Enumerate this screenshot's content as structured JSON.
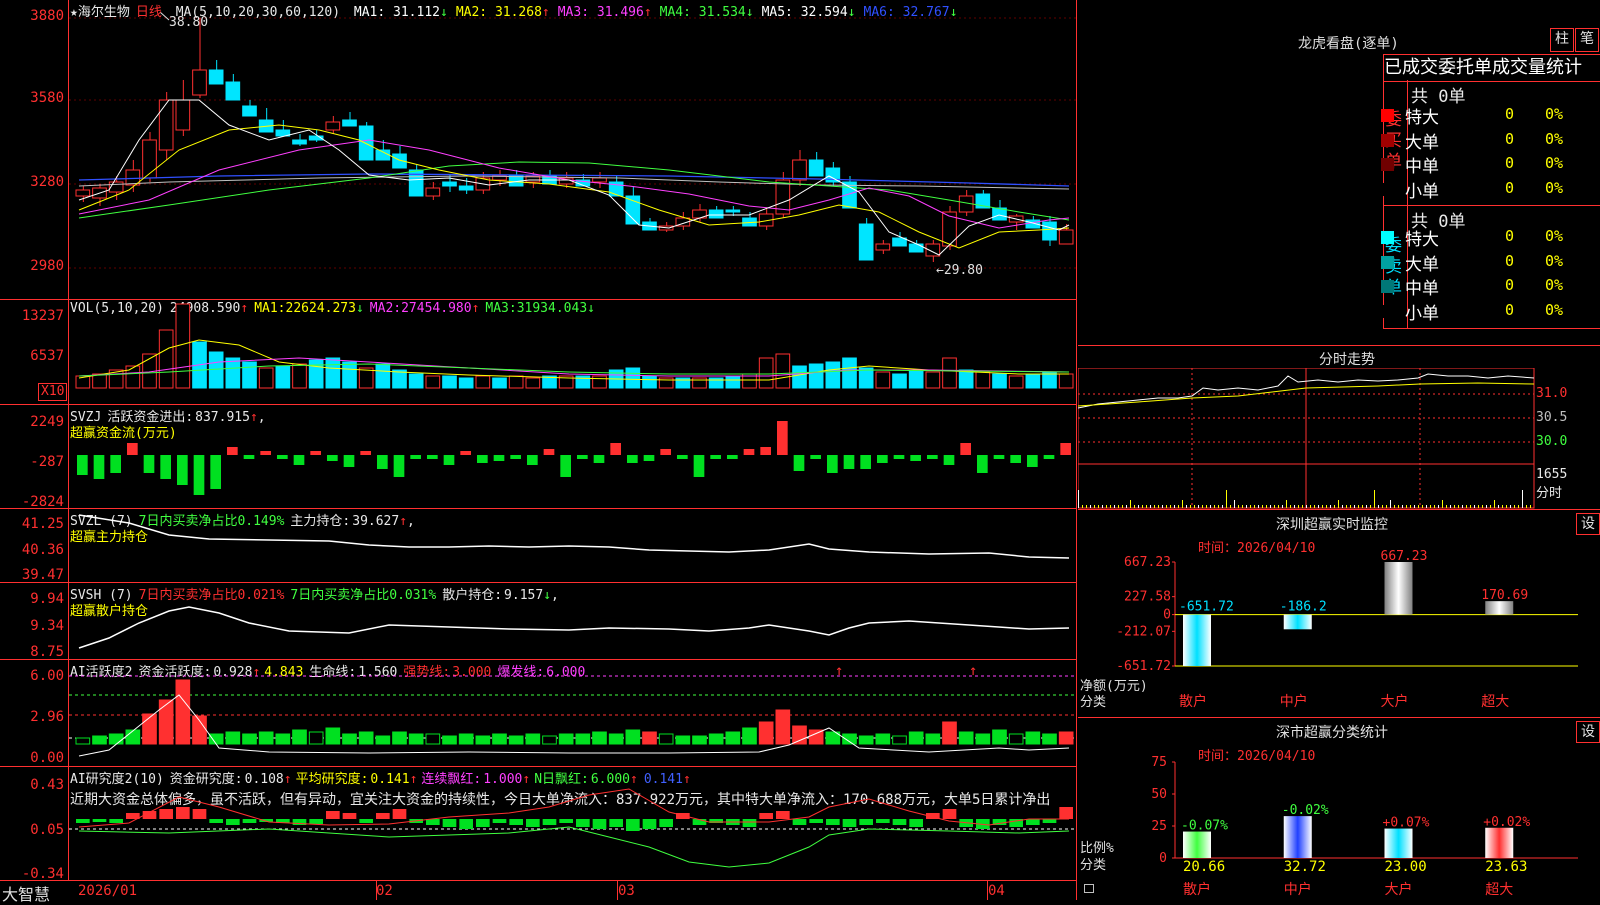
{
  "stock": {
    "name": "海尔生物",
    "period": "日线",
    "star": "★"
  },
  "colors": {
    "up": "#ff3030",
    "down": "#00e5ff",
    "bg": "#000000",
    "grid": "#a00000",
    "ma1": "#ffffff",
    "ma2": "#ffff00",
    "ma3": "#ff40ff",
    "ma4": "#40ff40",
    "ma5": "#c0c0c0",
    "ma6": "#3050ff"
  },
  "main_panel": {
    "ma_header": "MA(5,10,20,30,60,120)",
    "ma": [
      {
        "label": "MA1:",
        "value": "31.112",
        "arrow": "↓",
        "color": "#ffffff"
      },
      {
        "label": "MA2:",
        "value": "31.268",
        "arrow": "↑",
        "color": "#ffff00"
      },
      {
        "label": "MA3:",
        "value": "31.496",
        "arrow": "↑",
        "color": "#ff40ff"
      },
      {
        "label": "MA4:",
        "value": "31.534",
        "arrow": "↓",
        "color": "#40ff40"
      },
      {
        "label": "MA5:",
        "value": "32.594",
        "arrow": "↓",
        "color": "#ffffff"
      },
      {
        "label": "MA6:",
        "value": "32.767",
        "arrow": "↓",
        "color": "#3050ff"
      }
    ],
    "y_ticks": [
      "3880",
      "3580",
      "3280",
      "2980"
    ],
    "high_mark": "38.80",
    "low_mark": "←29.80"
  },
  "vol_panel": {
    "header": "VOL(5,10,20)",
    "value": "24908.590",
    "value_arrow": "↑",
    "ma": [
      {
        "label": "MA1:",
        "value": "22624.273",
        "arrow": "↓"
      },
      {
        "label": "MA2:",
        "value": "27454.980",
        "arrow": "↑"
      },
      {
        "label": "MA3:",
        "value": "31934.043",
        "arrow": "↓"
      }
    ],
    "y_ticks": [
      "13237",
      "6537"
    ],
    "unit": "X10"
  },
  "svzj_panel": {
    "header": "SVZJ",
    "label": "活跃资金进出:",
    "value": "837.915",
    "arrow": "↑",
    "tail": ",",
    "sub": "超赢资金流(万元)",
    "y_ticks": [
      "2249",
      "-287",
      "-2824"
    ]
  },
  "svzl_panel": {
    "header": "SVZL (7)",
    "ratio_label": "7日内买卖净占比",
    "ratio_value": "0.149%",
    "hold_label": "主力持仓:",
    "hold_value": "39.627",
    "arrow": "↑",
    "tail": ",",
    "sub": "超赢主力持仓",
    "y_ticks": [
      "41.25",
      "40.36",
      "39.47"
    ]
  },
  "svsh_panel": {
    "header": "SVSH (7)",
    "r1_label": "7日内买卖净占比",
    "r1_value": "0.021%",
    "r2_label": "7日内买卖净占比",
    "r2_value": "0.031%",
    "hold_label": "散户持仓:",
    "hold_value": "9.157",
    "arrow": "↓",
    "tail": ",",
    "sub": "超赢散户持仓",
    "y_ticks": [
      "9.94",
      "9.34",
      "8.75"
    ]
  },
  "ai_active_panel": {
    "header": "AI活跃度2",
    "l1": "资金活跃度:",
    "v1": "0.928",
    "a1": "↑",
    "v2": "4.843",
    "l3": "生命线:",
    "v3": "1.560",
    "l4": "强势线:",
    "v4": "3.000",
    "l5": "爆发线:",
    "v5": "6.000",
    "y_ticks": [
      "6.00",
      "2.96",
      "0.00"
    ]
  },
  "ai_research_panel": {
    "header": "AI研究度2(10)",
    "l1": "资金研究度:",
    "v1": "0.108",
    "a1": "↑",
    "l2": "平均研究度:",
    "v2": "0.141",
    "a2": "↑",
    "l3": "连续飘红:",
    "v3": "1.000",
    "a3": "↑",
    "l4": "N日飘红:",
    "v4": "6.000",
    "a4": "↑",
    "v5": "0.141",
    "a5": "↑",
    "comment": "近期大资金总体偏多，虽不活跃，但有异动，宜关注大资金的持续性，今日大单净流入：837.922万元，其中特大单净流入：170.688万元，大单5日累计净出",
    "y_ticks": [
      "0.43",
      "0.05",
      "-0.34"
    ]
  },
  "date_axis": {
    "labels": [
      "2026/01",
      "02",
      "03",
      "04"
    ]
  },
  "brand": "大智慧",
  "longhu": {
    "title": "龙虎看盘(逐单)",
    "btn_zhu": "柱",
    "btn_bi": "笔",
    "tabs": "已成交委托单成交量统计",
    "buy": {
      "side": "委买单",
      "count": "共 0单",
      "rows": [
        {
          "label": "特大",
          "value": "0",
          "pct": "0%",
          "color": "#ff0000"
        },
        {
          "label": "大单",
          "value": "0",
          "pct": "0%",
          "color": "#a00000"
        },
        {
          "label": "中单",
          "value": "0",
          "pct": "0%",
          "color": "#700000"
        },
        {
          "label": "小单",
          "value": "0",
          "pct": "0%",
          "color": "#000000"
        }
      ]
    },
    "sell": {
      "side": "委卖单",
      "count": "共 0单",
      "rows": [
        {
          "label": "特大",
          "value": "0",
          "pct": "0%",
          "color": "#00ffff"
        },
        {
          "label": "大单",
          "value": "0",
          "pct": "0%",
          "color": "#00a0a0"
        },
        {
          "label": "中单",
          "value": "0",
          "pct": "0%",
          "color": "#007878"
        },
        {
          "label": "小单",
          "value": "0",
          "pct": "0%",
          "color": "#000000"
        }
      ]
    }
  },
  "intraday": {
    "title": "分时走势",
    "price_ticks": [
      "31.0",
      "30.5",
      "30.0"
    ],
    "vol_tick": "1655",
    "vol_unit": "分时"
  },
  "sz_monitor": {
    "title": "深圳超赢实时监控",
    "btn": "设",
    "time": "时间：2026/04/10",
    "y_ticks": [
      "667.23",
      "227.58",
      "0",
      "-212.07",
      "-651.72"
    ],
    "bars": [
      {
        "cat": "散户",
        "value": -651.72,
        "label": "-651.72"
      },
      {
        "cat": "中户",
        "value": -186.2,
        "label": "-186.2"
      },
      {
        "cat": "大户",
        "value": 667.23,
        "label": "667.23"
      },
      {
        "cat": "超大",
        "value": 170.69,
        "label": "170.69"
      }
    ],
    "ylabel": "净额(万元)",
    "xlabel": "分类"
  },
  "sz_classify": {
    "title": "深市超赢分类统计",
    "btn": "设",
    "time": "时间：2026/04/10",
    "y_ticks": [
      "75",
      "50",
      "25",
      "0"
    ],
    "bars": [
      {
        "cat": "散户",
        "value": 20.66,
        "label": "20.66",
        "change": "-0.07%"
      },
      {
        "cat": "中户",
        "value": 32.72,
        "label": "32.72",
        "change": "-0.02%"
      },
      {
        "cat": "大户",
        "value": 23.0,
        "label": "23.00",
        "change": "+0.07%"
      },
      {
        "cat": "超大",
        "value": 23.63,
        "label": "23.63",
        "change": "+0.02%"
      }
    ],
    "ylabel": "比例%",
    "xlabel": "分类"
  },
  "chart_data": [
    {
      "type": "bar",
      "title": "深圳超赢实时监控",
      "categories": [
        "散户",
        "中户",
        "大户",
        "超大"
      ],
      "values": [
        -651.72,
        -186.2,
        667.23,
        170.69
      ],
      "ylabel": "净额(万元)",
      "xlabel": "分类",
      "ylim": [
        -651.72,
        667.23
      ]
    },
    {
      "type": "bar",
      "title": "深市超赢分类统计",
      "categories": [
        "散户",
        "中户",
        "大户",
        "超大"
      ],
      "values": [
        20.66,
        32.72,
        23.0,
        23.63
      ],
      "ylabel": "比例%",
      "xlabel": "分类",
      "ylim": [
        0,
        75
      ]
    }
  ]
}
